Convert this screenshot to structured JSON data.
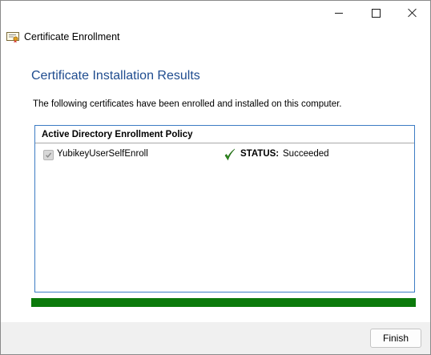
{
  "window": {
    "title": "Certificate Enrollment",
    "controls": {
      "minimize": "minimize-icon",
      "maximize": "maximize-icon",
      "close": "close-icon"
    }
  },
  "page": {
    "heading": "Certificate Installation Results",
    "instruction": "The following certificates have been enrolled and installed on this computer."
  },
  "policy": {
    "name": "Active Directory Enrollment Policy",
    "certificates": [
      {
        "name": "YubikeyUserSelfEnroll",
        "checked": true,
        "status_label": "STATUS:",
        "status_value": "Succeeded"
      }
    ]
  },
  "progress": {
    "fraction": 1.0,
    "color": "#0b7a0b"
  },
  "footer": {
    "finish_label": "Finish"
  },
  "colors": {
    "heading": "#1f4c8f",
    "panel_border": "#3d7cc4",
    "check_green": "#2e8b1e",
    "footer_bg": "#f0f0f0"
  }
}
